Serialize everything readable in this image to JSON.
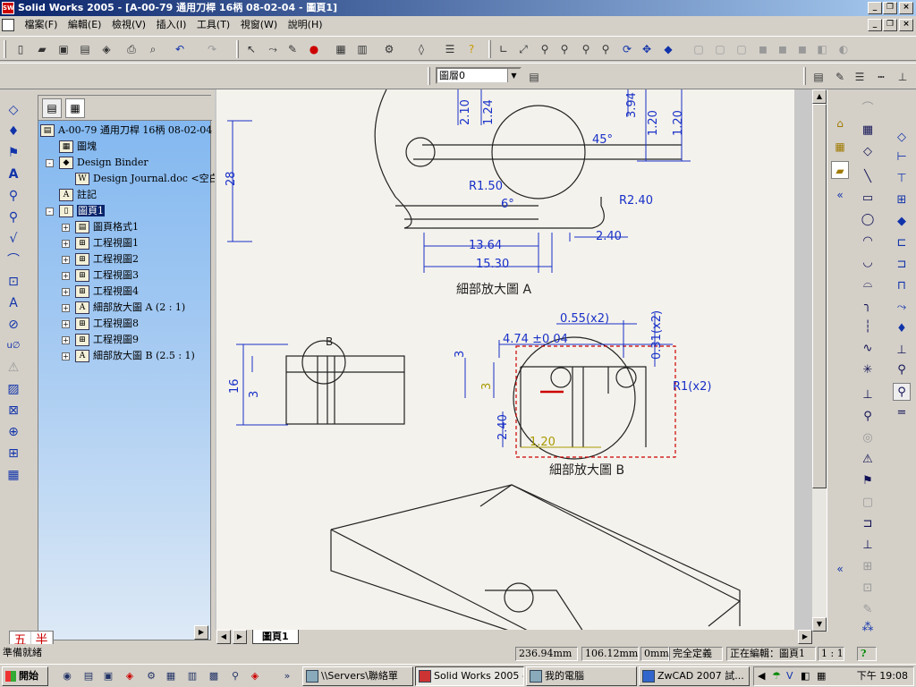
{
  "window": {
    "title": "Solid Works 2005 - [A-00-79 通用刀桿 16柄 08-02-04 - 圖頁1]",
    "app_icon": "solidworks-icon"
  },
  "menu": [
    "檔案(F)",
    "編輯(E)",
    "檢視(V)",
    "插入(I)",
    "工具(T)",
    "視窗(W)",
    "說明(H)"
  ],
  "layer_select": {
    "value": "圖層0"
  },
  "tree": {
    "root": "A-00-79 通用刀桿 16柄 08-02-04",
    "nodes": [
      {
        "label": "圖塊",
        "icon": "block-icon",
        "level": 1,
        "expand": ""
      },
      {
        "label": "Design Binder",
        "icon": "binder-icon",
        "level": 1,
        "expand": "-"
      },
      {
        "label": "Design Journal.doc <空白>",
        "icon": "word-doc-icon",
        "level": 2,
        "expand": ""
      },
      {
        "label": "註記",
        "icon": "annotation-icon",
        "level": 1,
        "expand": ""
      },
      {
        "label": "圖頁1",
        "icon": "sheet-icon",
        "level": 1,
        "expand": "-",
        "selected": true
      },
      {
        "label": "圖頁格式1",
        "icon": "sheet-format-icon",
        "level": 2,
        "expand": "+"
      },
      {
        "label": "工程視圖1",
        "icon": "drawing-view-icon",
        "level": 2,
        "expand": "+"
      },
      {
        "label": "工程視圖2",
        "icon": "drawing-view-icon",
        "level": 2,
        "expand": "+"
      },
      {
        "label": "工程視圖3",
        "icon": "drawing-view-icon",
        "level": 2,
        "expand": "+"
      },
      {
        "label": "工程視圖4",
        "icon": "drawing-view-icon",
        "level": 2,
        "expand": "+"
      },
      {
        "label": "細部放大圖 A (2 : 1)",
        "icon": "detail-view-icon",
        "level": 2,
        "expand": "+"
      },
      {
        "label": "工程視圖8",
        "icon": "drawing-view-icon",
        "level": 2,
        "expand": "+"
      },
      {
        "label": "工程視圖9",
        "icon": "drawing-view-icon",
        "level": 2,
        "expand": "+"
      },
      {
        "label": "細部放大圖 B (2.5 : 1)",
        "icon": "detail-view-icon",
        "level": 2,
        "expand": "+"
      }
    ]
  },
  "drawing": {
    "dims_a": [
      "2.10",
      "1.24",
      "3.94",
      "1.20",
      "1.20",
      "45°",
      "R1.50",
      "6°",
      "R2.40",
      "13.64",
      "2.40",
      "15.30",
      "28"
    ],
    "title_a": "細部放大圖 A",
    "dims_b": [
      "0.55(x2)",
      "0.31(x2)",
      "4.74 ±0.04",
      "3",
      "3",
      "R1(x2)",
      "2.40",
      "1.20"
    ],
    "title_b": "細部放大圖 B",
    "dims_left": [
      "16",
      "3"
    ],
    "balloon_b": "B"
  },
  "sheet_tab": "圖頁1",
  "status": {
    "x": "236.94mm",
    "y": "106.12mm",
    "z": "0mm",
    "state": "完全定義",
    "editing": "正在編輯：圖頁1",
    "scale": "1 : 1",
    "help": "?"
  },
  "ime": {
    "a": "五",
    "b": "半"
  },
  "status_left": "準備就緒",
  "taskbar": {
    "start": "開始",
    "tasks": [
      {
        "label": "\\\\Servers\\聯絡單",
        "active": false
      },
      {
        "label": "Solid Works 2005 -...",
        "active": true
      },
      {
        "label": "我的電腦",
        "active": false
      },
      {
        "label": "ZwCAD 2007 試...",
        "active": false
      }
    ],
    "clock": "下午 19:08"
  }
}
